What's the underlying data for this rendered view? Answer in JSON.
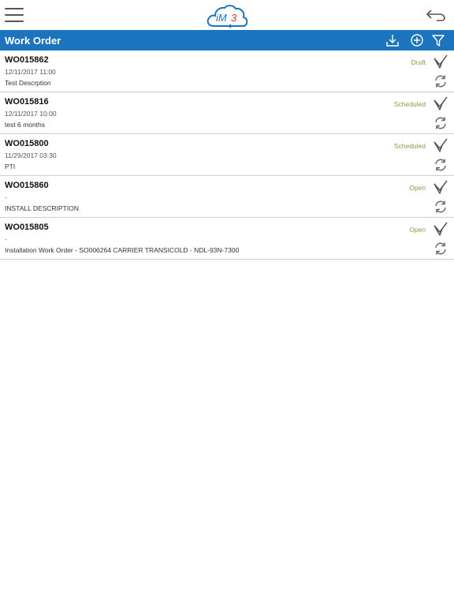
{
  "header": {
    "logo_text": "iM3",
    "menu_icon": "hamburger-menu-icon",
    "back_icon": "back-arrow-icon"
  },
  "titlebar": {
    "title": "Work Order",
    "background_color": "#1c74bf",
    "icons": [
      "download-icon",
      "add-circle-icon",
      "filter-icon"
    ]
  },
  "colors": {
    "status_text": "#8a9a4a",
    "logo_blue": "#1c74bf",
    "logo_red": "#d9342b"
  },
  "work_orders": [
    {
      "id": "WO015862",
      "datetime": "12/11/2017 11:00",
      "description": "Test Descrption",
      "status": "Draft"
    },
    {
      "id": "WO015816",
      "datetime": "12/11/2017 10:00",
      "description": "test 6 months",
      "status": "Scheduled"
    },
    {
      "id": "WO015800",
      "datetime": "11/29/2017 03:30",
      "description": "PTI",
      "status": "Scheduled"
    },
    {
      "id": "WO015860",
      "datetime": "-",
      "description": "INSTALL DESCRIPTION",
      "status": "Open"
    },
    {
      "id": "WO015805",
      "datetime": "-",
      "description": "Installation Work Order - SO006264 CARRIER TRANSICOLD - NDL-93N-7300",
      "status": "Open"
    }
  ]
}
